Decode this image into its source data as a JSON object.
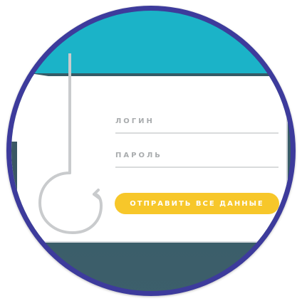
{
  "form": {
    "login_placeholder": "ЛОГИН",
    "password_placeholder": "ПАРОЛЬ",
    "submit_label": "ОТПРАВИТЬ ВСЕ ДАННЫЕ"
  },
  "colors": {
    "badge_border": "#3d3b9c",
    "header_teal": "#1bb3c8",
    "background_dark": "#3a5764",
    "button_yellow": "#f7c72a"
  },
  "icons": {
    "hook": "fishing-hook-icon"
  }
}
